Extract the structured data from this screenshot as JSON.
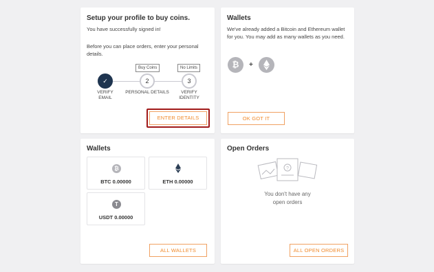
{
  "setup": {
    "title": "Setup your profile to buy coins.",
    "signed_in": "You have successfully signed in!",
    "instructions": "Before you can place orders, enter your personal details.",
    "tags": {
      "buy": "Buy Coins",
      "limits": "No Limits"
    },
    "steps": [
      {
        "number": "✓",
        "label": "VERIFY EMAIL"
      },
      {
        "number": "2",
        "label": "PERSONAL DETAILS"
      },
      {
        "number": "3",
        "label": "VERIFY IDENTITY"
      }
    ],
    "button": "ENTER DETAILS"
  },
  "wallets_info": {
    "title": "Wallets",
    "text": "We've already added a Bitcoin and Ethereum wallet for you. You may add as many wallets as you need.",
    "plus": "+",
    "button": "OK GOT IT"
  },
  "wallets": {
    "title": "Wallets",
    "items": [
      {
        "label": "BTC 0.00000",
        "icon": "bitcoin-icon"
      },
      {
        "label": "ETH 0.00000",
        "icon": "ethereum-icon"
      },
      {
        "label": "USDT 0.00000",
        "icon": "tether-icon"
      }
    ],
    "button": "ALL WALLETS"
  },
  "orders": {
    "title": "Open Orders",
    "empty": "You don't have any open orders",
    "button": "ALL OPEN ORDERS"
  },
  "colors": {
    "accent": "#f08a2c",
    "navy": "#1f3550",
    "highlight": "#a01818"
  }
}
